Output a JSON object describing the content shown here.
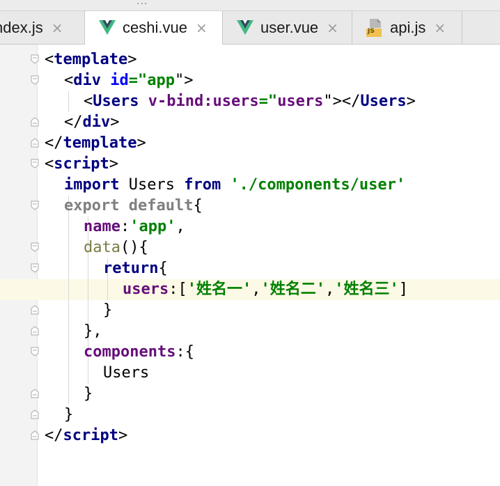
{
  "tabs": [
    {
      "label": "ndex.js",
      "icon": "none"
    },
    {
      "label": "ceshi.vue",
      "icon": "vue-icon",
      "active": true
    },
    {
      "label": "user.vue",
      "icon": "vue-icon"
    },
    {
      "label": "api.js",
      "icon": "js-icon",
      "icon_text": "JS"
    }
  ],
  "close_glyph": "×",
  "more_glyph": "...",
  "colors": {
    "tag": "#000080",
    "attribute": "#0000ff",
    "string": "#008000",
    "property": "#660e7a",
    "highlight_line": "#fcf9e6"
  },
  "code": {
    "l1": {
      "a": "<",
      "b": "template",
      "c": ">"
    },
    "l2": {
      "a": "<",
      "b": "div",
      "c": " ",
      "d": "id",
      "e": "=\"",
      "f": "app",
      "g": "\">"
    },
    "l3": {
      "a": "<",
      "b": "Users",
      "c": " ",
      "d": "v-bind:users",
      "e": "=\"",
      "f": "users",
      "g": "\"></",
      "h": "Users",
      "i": ">"
    },
    "l4": {
      "a": "</",
      "b": "div",
      "c": ">"
    },
    "l5": {
      "a": "</",
      "b": "template",
      "c": ">"
    },
    "l6": {
      "a": "<",
      "b": "script",
      "c": ">"
    },
    "l7": {
      "a": "import",
      "b": " Users ",
      "c": "from",
      "d": " ",
      "e": "'./components/user'"
    },
    "l8": {
      "a": "export",
      "b": " ",
      "c": "default",
      "d": "{"
    },
    "l9": {
      "a": "name",
      "b": ":",
      "c": "'app'",
      "d": ","
    },
    "l10": {
      "a": "data",
      "b": "(){"
    },
    "l11": {
      "a": "return",
      "b": "{"
    },
    "l12": {
      "a": "users",
      "b": ":[",
      "c": "'姓名一'",
      "d": ",",
      "e": "'姓名二'",
      "f": ",",
      "g": "'姓名三'",
      "h": "]"
    },
    "l13": {
      "a": "}"
    },
    "l14": {
      "a": "},"
    },
    "l15": {
      "a": "components",
      "b": ":{"
    },
    "l16": {
      "a": "Users"
    },
    "l17": {
      "a": "}"
    },
    "l18": {
      "a": "}"
    },
    "l19": {
      "a": "</",
      "b": "script",
      "c": ">"
    }
  }
}
